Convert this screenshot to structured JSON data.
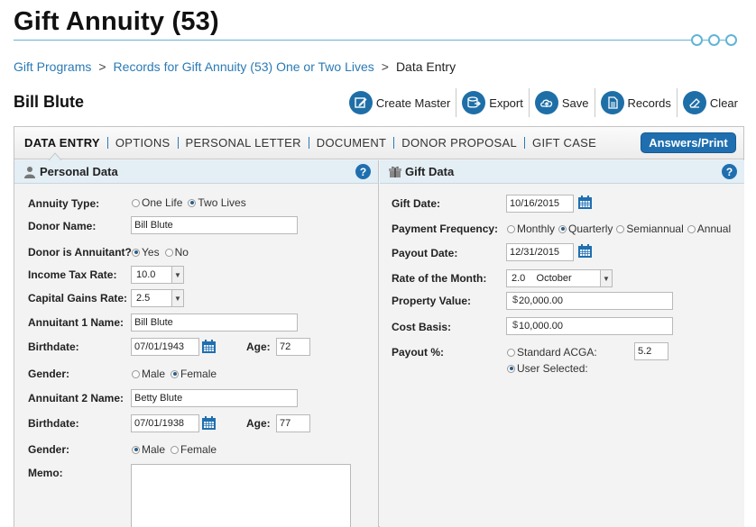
{
  "header": {
    "title": "Gift Annuity (53)",
    "breadcrumb": [
      "Gift Programs",
      "Records for Gift Annuity (53) One or Two Lives",
      "Data Entry"
    ],
    "breadcrumb_sep": ">"
  },
  "record": {
    "name": "Bill Blute"
  },
  "toolbar": {
    "create_master": "Create Master",
    "export": "Export",
    "save": "Save",
    "records": "Records",
    "clear": "Clear"
  },
  "tabs": [
    "DATA ENTRY",
    "OPTIONS",
    "PERSONAL LETTER",
    "DOCUMENT",
    "DONOR PROPOSAL",
    "GIFT CASE"
  ],
  "answers_button": "Answers/Print",
  "personal": {
    "heading": "Personal Data",
    "annuity_type_label": "Annuity Type:",
    "annuity_type_options": [
      "One Life",
      "Two Lives"
    ],
    "annuity_type_selected": "Two Lives",
    "donor_name_label": "Donor Name:",
    "donor_name_value": "Bill Blute",
    "donor_is_annuitant_label": "Donor is Annuitant?",
    "donor_is_annuitant_options": [
      "Yes",
      "No"
    ],
    "donor_is_annuitant_selected": "Yes",
    "income_tax_label": "Income Tax Rate:",
    "income_tax_value": "10.0",
    "capital_gains_label": "Capital Gains Rate:",
    "capital_gains_value": "2.5",
    "annuitant1_label": "Annuitant 1 Name:",
    "annuitant1_value": "Bill Blute",
    "birthdate_label": "Birthdate:",
    "birthdate1_value": "07/01/1943",
    "age_label": "Age:",
    "age1_value": "72",
    "gender_label": "Gender:",
    "gender_options": [
      "Male",
      "Female"
    ],
    "gender1_selected": "Female",
    "annuitant2_label": "Annuitant 2 Name:",
    "annuitant2_value": "Betty Blute",
    "birthdate2_value": "07/01/1938",
    "age2_value": "77",
    "gender2_selected": "Male",
    "memo_label": "Memo:",
    "memo_value": ""
  },
  "gift": {
    "heading": "Gift Data",
    "gift_date_label": "Gift Date:",
    "gift_date_value": "10/16/2015",
    "payment_freq_label": "Payment Frequency:",
    "payment_freq_options": [
      "Monthly",
      "Quarterly",
      "Semiannual",
      "Annual"
    ],
    "payment_freq_selected": "Quarterly",
    "payout_date_label": "Payout Date:",
    "payout_date_value": "12/31/2015",
    "rate_month_label": "Rate of the Month:",
    "rate_month_value": "2.0    October",
    "property_value_label": "Property Value:",
    "property_value_value": "20,000.00",
    "cost_basis_label": "Cost Basis:",
    "cost_basis_value": "10,000.00",
    "currency_symbol": "$",
    "payout_pct_label": "Payout %:",
    "payout_options": [
      "Standard ACGA:",
      "User Selected:"
    ],
    "payout_selected": "User Selected:",
    "payout_pct_value": "5.2"
  },
  "colors": {
    "accent": "#1f6fb0",
    "rule": "#62b4d8",
    "link": "#2a7ab5"
  }
}
